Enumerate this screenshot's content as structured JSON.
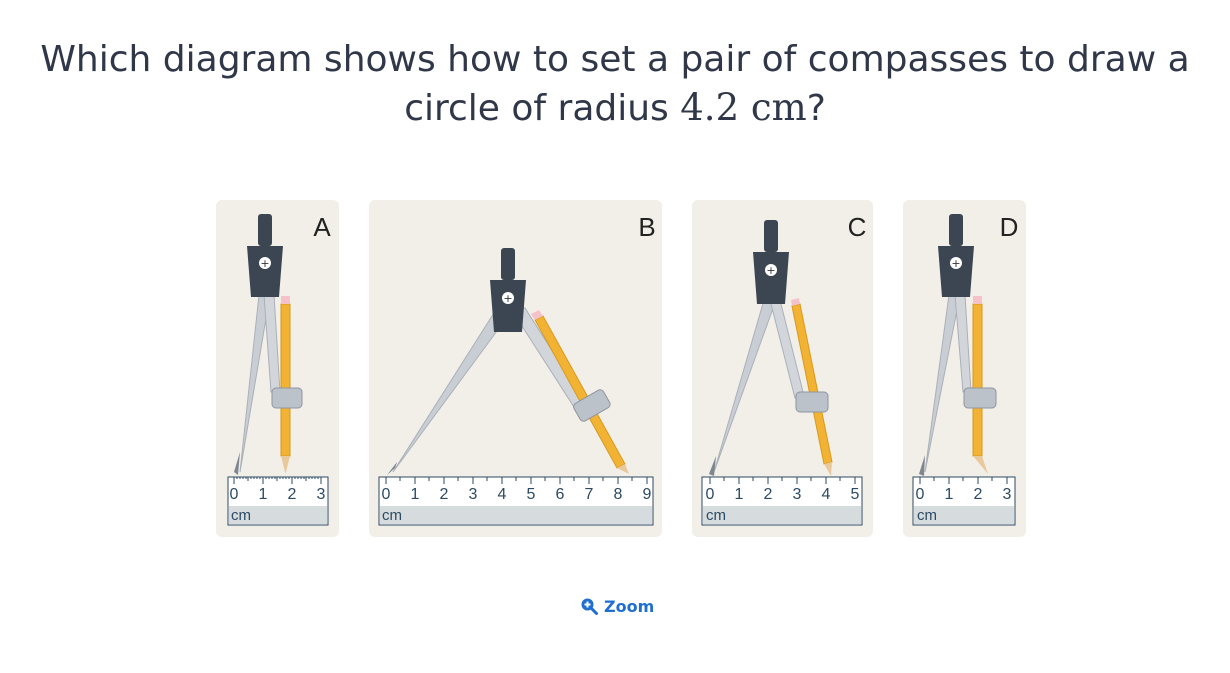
{
  "question": {
    "prefix": "Which diagram shows how to set a pair of compasses to draw a circle of radius ",
    "math": "4.2 cm",
    "suffix": "?"
  },
  "options": [
    {
      "label": "A",
      "ticks": [
        "0",
        "1",
        "2",
        "3"
      ],
      "unit": "cm"
    },
    {
      "label": "B",
      "ticks": [
        "0",
        "1",
        "2",
        "3",
        "4",
        "5",
        "6",
        "7",
        "8",
        "9"
      ],
      "unit": "cm"
    },
    {
      "label": "C",
      "ticks": [
        "0",
        "1",
        "2",
        "3",
        "4",
        "5"
      ],
      "unit": "cm"
    },
    {
      "label": "D",
      "ticks": [
        "0",
        "1",
        "2",
        "3"
      ],
      "unit": "cm"
    }
  ],
  "zoom": {
    "label": "Zoom",
    "icon": "zoom-in-icon"
  },
  "colors": {
    "card_bg": "#f2efe9",
    "ruler": "#d6dbdd",
    "ruler_ink": "#2c4a63",
    "pencil": "#f2b234",
    "compass_head": "#3c4653",
    "arm": "#c8cdd3",
    "link": "#1f6fd1"
  }
}
